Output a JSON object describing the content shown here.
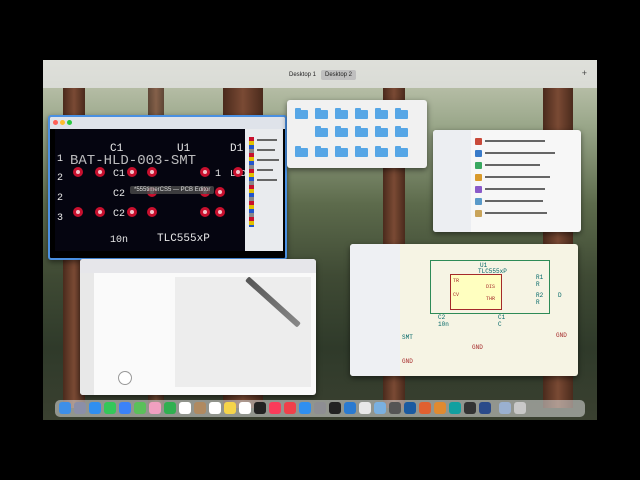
{
  "desktop": {
    "tabs": [
      "Desktop 1",
      "Desktop 2"
    ],
    "active_tab": 1,
    "add_label": "+"
  },
  "pcb_editor": {
    "tooltip": "*555timerCS5 — PCB Editor",
    "refs": {
      "c1": "C1",
      "u1": "U1",
      "d1": "D1",
      "c2": "C2",
      "c2b": "C2",
      "c1b": "C1"
    },
    "texts": {
      "footprint": "BAT-HLD-003-SMT",
      "value_10n": "10n",
      "part": "TLC555xP",
      "led": "LED"
    },
    "pin_numbers": [
      "1",
      "2",
      "2",
      "3",
      "1"
    ]
  },
  "schematic": {
    "refs": {
      "u1": "U1",
      "part": "TLC555xP",
      "r1": "R1",
      "r2": "R2",
      "c1": "C1",
      "c2": "C2",
      "rr": "R",
      "rr2": "R",
      "d": "D"
    },
    "labels": {
      "gnd1": "GND",
      "gnd2": "GND",
      "gnd3": "GND",
      "smt": "SMT",
      "c_val": "C",
      "tr": "TR",
      "cv": "CV",
      "dis": "DIS",
      "thr": "THR",
      "val_10n": "10n"
    }
  },
  "colors": {
    "pad": "#c8102e",
    "folder": "#56a6e6",
    "wire": "#2e8b57",
    "component": "#a52a2a"
  }
}
